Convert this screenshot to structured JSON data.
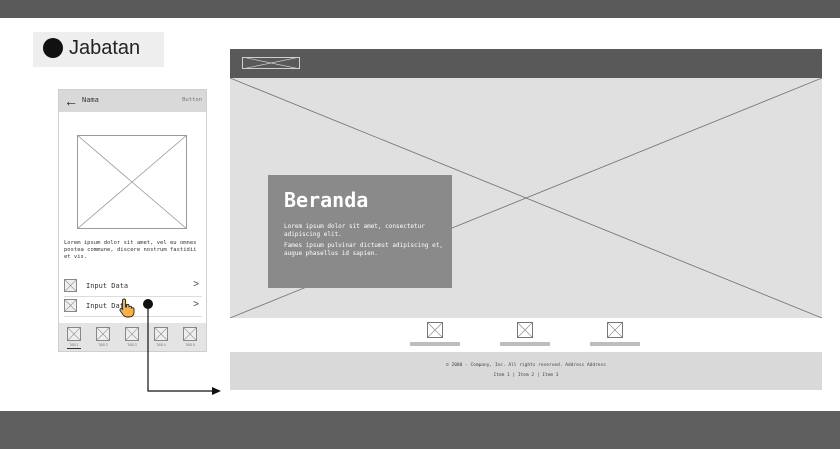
{
  "label": {
    "text": "Jabatan"
  },
  "mobile": {
    "header": {
      "back_icon": "←",
      "title": "Nama",
      "button_label": "Button"
    },
    "description": "Lorem ipsum dolor sit amet, vel eu omnes postea commune, discere nostrum fastidii et vis.",
    "rows": [
      {
        "label": "Input Data",
        "chevron": ">"
      },
      {
        "label": "Input Data",
        "chevron": ">"
      }
    ],
    "tabs": [
      "TAB 1",
      "TAB 2",
      "TAB 3",
      "TAB 4",
      "TAB 5"
    ]
  },
  "web": {
    "hero": {
      "title": "Beranda",
      "text1": "Lorem ipsum dolor sit amet, consectetur adipiscing elit.",
      "text2": "Fames ipsum pulvinar dictumst adipiscing et, augue phasellus id sapien."
    },
    "footer": {
      "copyright": "© 2000 - Company, Inc. All rights reserved. Address Address",
      "links": "Item 1  |  Item 2  |  Item 3"
    }
  },
  "icons": {
    "hand": "hand-pointer-icon",
    "placeholder": "image-placeholder-icon",
    "back": "arrow-left-icon"
  },
  "colors": {
    "bar_dark": "#5a5a5a",
    "hero_box": "#8a8a8a",
    "hero_bg": "#e0e0e0"
  }
}
